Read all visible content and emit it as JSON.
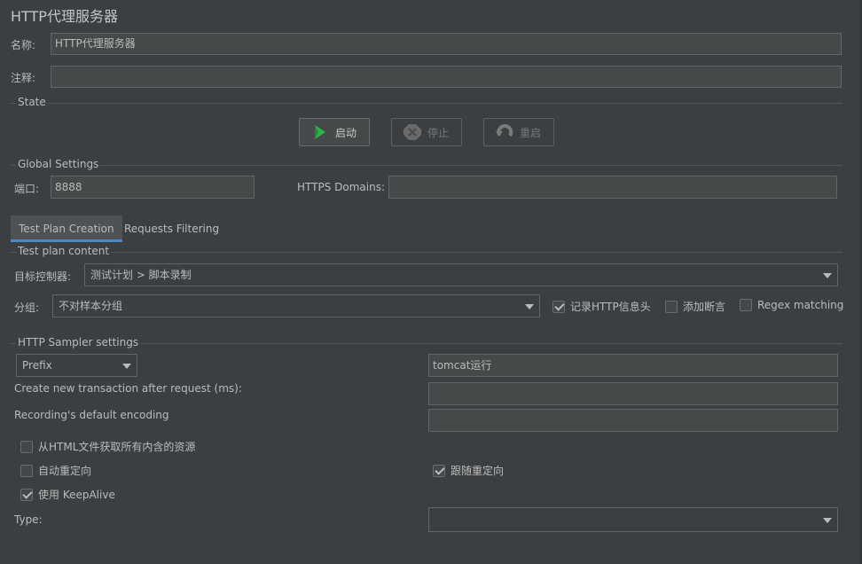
{
  "window": {
    "title": "HTTP代理服务器"
  },
  "name_field": {
    "label": "名称:",
    "value": "HTTP代理服务器"
  },
  "comment_field": {
    "label": "注释:",
    "value": ""
  },
  "state": {
    "section_title": "State",
    "start_label": "启动",
    "stop_label": "停止",
    "restart_label": "重启"
  },
  "global": {
    "section_title": "Global Settings",
    "port_label": "端口:",
    "port_value": "8888",
    "https_label": "HTTPS Domains:",
    "https_value": ""
  },
  "tabs": [
    {
      "label": "Test Plan Creation",
      "active": true
    },
    {
      "label": "Requests Filtering",
      "active": false
    }
  ],
  "plan": {
    "section_title": "Test plan content",
    "target_label": "目标控制器:",
    "target_value": "测试计划 > 脚本录制",
    "group_label": "分组:",
    "group_value": "不对样本分组",
    "record_headers_label": "记录HTTP信息头",
    "record_headers_checked": true,
    "add_assertions_label": "添加断言",
    "add_assertions_checked": false,
    "regex_label": "Regex matching",
    "regex_checked": false
  },
  "sampler": {
    "section_title": "HTTP Sampler settings",
    "naming_value": "Prefix",
    "prefix_value": "tomcat运行",
    "transaction_label": "Create new transaction after request (ms):",
    "transaction_value": "",
    "encoding_label": "Recording's default encoding",
    "encoding_value": "",
    "retrieve_resources_label": "从HTML文件获取所有内含的资源",
    "retrieve_resources_checked": false,
    "auto_redirect_label": "自动重定向",
    "auto_redirect_checked": false,
    "follow_redirect_label": "跟随重定向",
    "follow_redirect_checked": true,
    "keepalive_label": "使用 KeepAlive",
    "keepalive_checked": true,
    "type_label": "Type:",
    "type_value": ""
  },
  "colors": {
    "background": "#3c3f41",
    "field": "#45494a",
    "tab_accent": "#4a88c7",
    "start_icon": "#2fb44a"
  }
}
